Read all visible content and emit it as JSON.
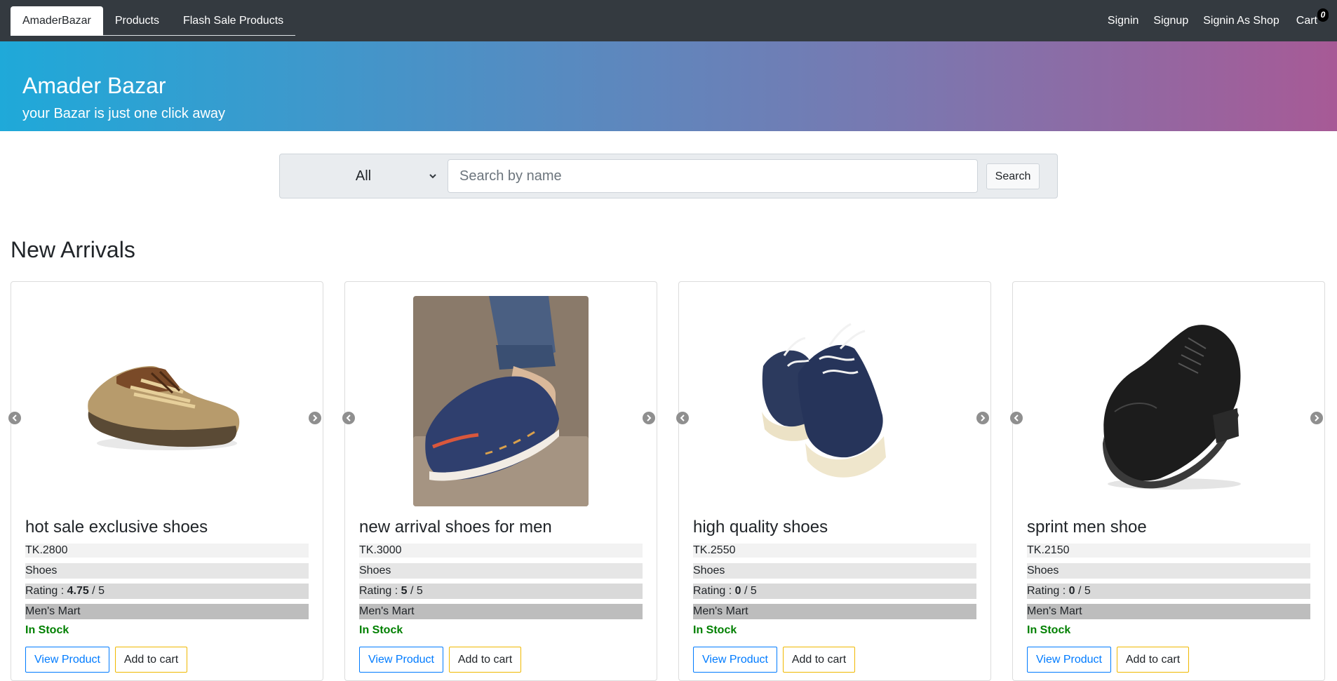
{
  "navbar": {
    "tabs": [
      {
        "label": "AmaderBazar",
        "active": true
      },
      {
        "label": "Products",
        "active": false
      },
      {
        "label": "Flash Sale Products",
        "active": false
      }
    ],
    "links": {
      "signin": "Signin",
      "signup": "Signup",
      "signin_shop": "Signin As Shop",
      "cart": "Cart",
      "cart_count": "0"
    }
  },
  "hero": {
    "title": "Amader Bazar",
    "subtitle": "your Bazar is just one click away"
  },
  "search": {
    "category_selected": "All",
    "placeholder": "Search by name",
    "value": "",
    "button_label": "Search"
  },
  "section": {
    "title": "New Arrivals"
  },
  "products": [
    {
      "name": "hot sale exclusive shoes",
      "price": "TK.2800",
      "category": "Shoes",
      "rating_label": "Rating : ",
      "rating_value": "4.75",
      "rating_max": " / 5",
      "shop": "Men's Mart",
      "stock": "In Stock",
      "view_label": "View Product",
      "cart_label": "Add to cart",
      "image_icon": "brown-sneaker-image"
    },
    {
      "name": "new arrival shoes for men",
      "price": "TK.3000",
      "category": "Shoes",
      "rating_label": "Rating : ",
      "rating_value": "5",
      "rating_max": " / 5",
      "shop": "Men's Mart",
      "stock": "In Stock",
      "view_label": "View Product",
      "cart_label": "Add to cart",
      "image_icon": "navy-loafer-image"
    },
    {
      "name": "high quality shoes",
      "price": "TK.2550",
      "category": "Shoes",
      "rating_label": "Rating : ",
      "rating_value": "0",
      "rating_max": " / 5",
      "shop": "Men's Mart",
      "stock": "In Stock",
      "view_label": "View Product",
      "cart_label": "Add to cart",
      "image_icon": "navy-platform-sneaker-image"
    },
    {
      "name": "sprint men shoe",
      "price": "TK.2150",
      "category": "Shoes",
      "rating_label": "Rating : ",
      "rating_value": "0",
      "rating_max": " / 5",
      "shop": "Men's Mart",
      "stock": "In Stock",
      "view_label": "View Product",
      "cart_label": "Add to cart",
      "image_icon": "black-oxford-image"
    }
  ],
  "colors": {
    "navbar_bg": "#343a40",
    "hero_gradient_start": "#1fa9d9",
    "hero_gradient_end": "#a75a96",
    "in_stock": "#008000",
    "view_button": "#007bff",
    "cart_button": "#f0b800"
  }
}
